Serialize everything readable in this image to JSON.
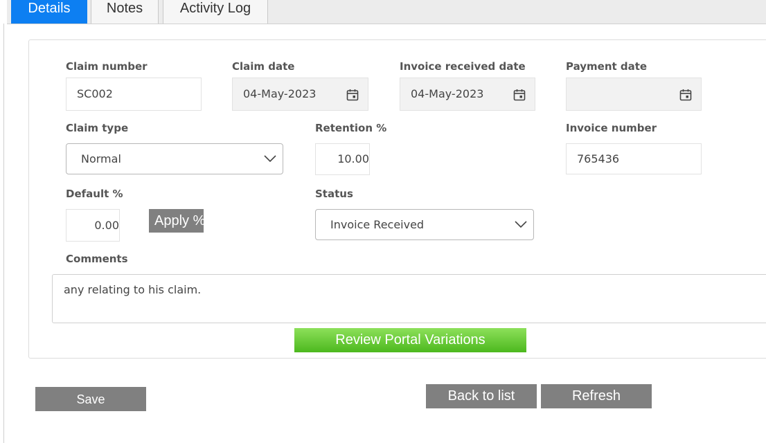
{
  "tabs": [
    {
      "label": "Details",
      "active": true
    },
    {
      "label": "Notes",
      "active": false
    },
    {
      "label": "Activity Log",
      "active": false
    }
  ],
  "form": {
    "claim_number": {
      "label": "Claim number",
      "value": "SC002"
    },
    "claim_date": {
      "label": "Claim date",
      "value": "04-May-2023"
    },
    "invoice_received_date": {
      "label": "Invoice received date",
      "value": "04-May-2023"
    },
    "payment_date": {
      "label": "Payment date",
      "value": ""
    },
    "claim_type": {
      "label": "Claim type",
      "value": "Normal"
    },
    "retention": {
      "label": "Retention %",
      "value": "10.00"
    },
    "invoice_number": {
      "label": "Invoice number",
      "value": "765436"
    },
    "default_pct": {
      "label": "Default %",
      "value": "0.00"
    },
    "apply_button": "Apply %",
    "status": {
      "label": "Status",
      "value": "Invoice Received"
    },
    "comments": {
      "label": "Comments",
      "value": "any relating to his claim."
    },
    "review_button": "Review Portal Variations"
  },
  "actions": {
    "save": "Save",
    "back": "Back to list",
    "refresh": "Refresh"
  },
  "icons": {
    "calendar": "calendar-icon",
    "chevron": "chevron-down-icon"
  },
  "colors": {
    "active_tab": "#0d7ff2",
    "grey_button": "#808080",
    "green_button": "#5cc52a"
  }
}
